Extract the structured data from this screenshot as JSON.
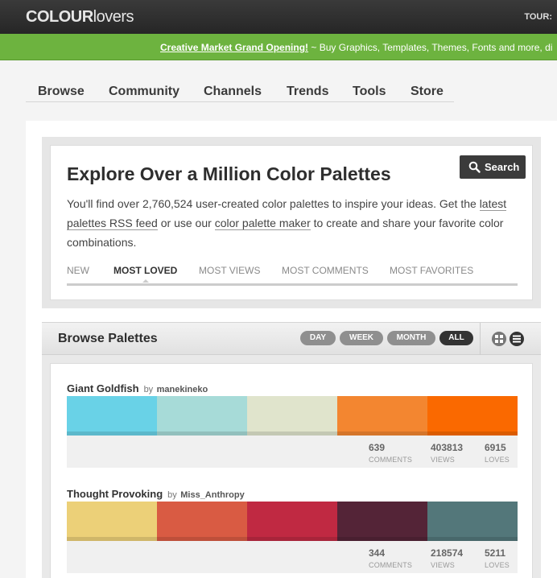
{
  "header": {
    "logo_bold": "COLOUR",
    "logo_light": "lovers",
    "tour_label": "TOUR:"
  },
  "promo": {
    "highlight": "Creative Market Grand Opening!",
    "text": " ~ Buy Graphics, Templates, Themes, Fonts and more, di"
  },
  "nav": {
    "items": [
      "Browse",
      "Community",
      "Channels",
      "Trends",
      "Tools",
      "Store"
    ]
  },
  "explore": {
    "title": "Explore Over a Million Color Palettes",
    "search_label": "Search",
    "desc_1": "You'll find over 2,760,524 user-created color palettes to inspire your ideas. Get the ",
    "link_rss": "latest palettes RSS feed",
    "desc_2": " or use our ",
    "link_maker": "color palette maker",
    "desc_3": " to create and share your favorite color combinations.",
    "filters": [
      "NEW",
      "MOST LOVED",
      "MOST VIEWS",
      "MOST COMMENTS",
      "MOST FAVORITES"
    ],
    "active_filter": "MOST LOVED"
  },
  "browse": {
    "title": "Browse Palettes",
    "periods": [
      "DAY",
      "WEEK",
      "MONTH",
      "ALL"
    ],
    "active_period": "ALL",
    "view_icons": [
      "grid-view-icon",
      "list-view-icon"
    ]
  },
  "palettes": [
    {
      "name": "Giant Goldfish",
      "by": "by",
      "user": "manekineko",
      "colors": [
        "#69d2e7",
        "#a7dbd8",
        "#e0e4cc",
        "#f38630",
        "#fa6900"
      ],
      "comments": "639",
      "views": "403813",
      "loves": "6915",
      "comments_label": "COMMENTS",
      "views_label": "VIEWS",
      "loves_label": "LOVES"
    },
    {
      "name": "Thought Provoking",
      "by": "by",
      "user": "Miss_Anthropy",
      "colors": [
        "#ecd078",
        "#d95b43",
        "#c02942",
        "#542437",
        "#53777a"
      ],
      "comments": "344",
      "views": "218574",
      "loves": "5211",
      "comments_label": "COMMENTS",
      "views_label": "VIEWS",
      "loves_label": "LOVES"
    }
  ]
}
